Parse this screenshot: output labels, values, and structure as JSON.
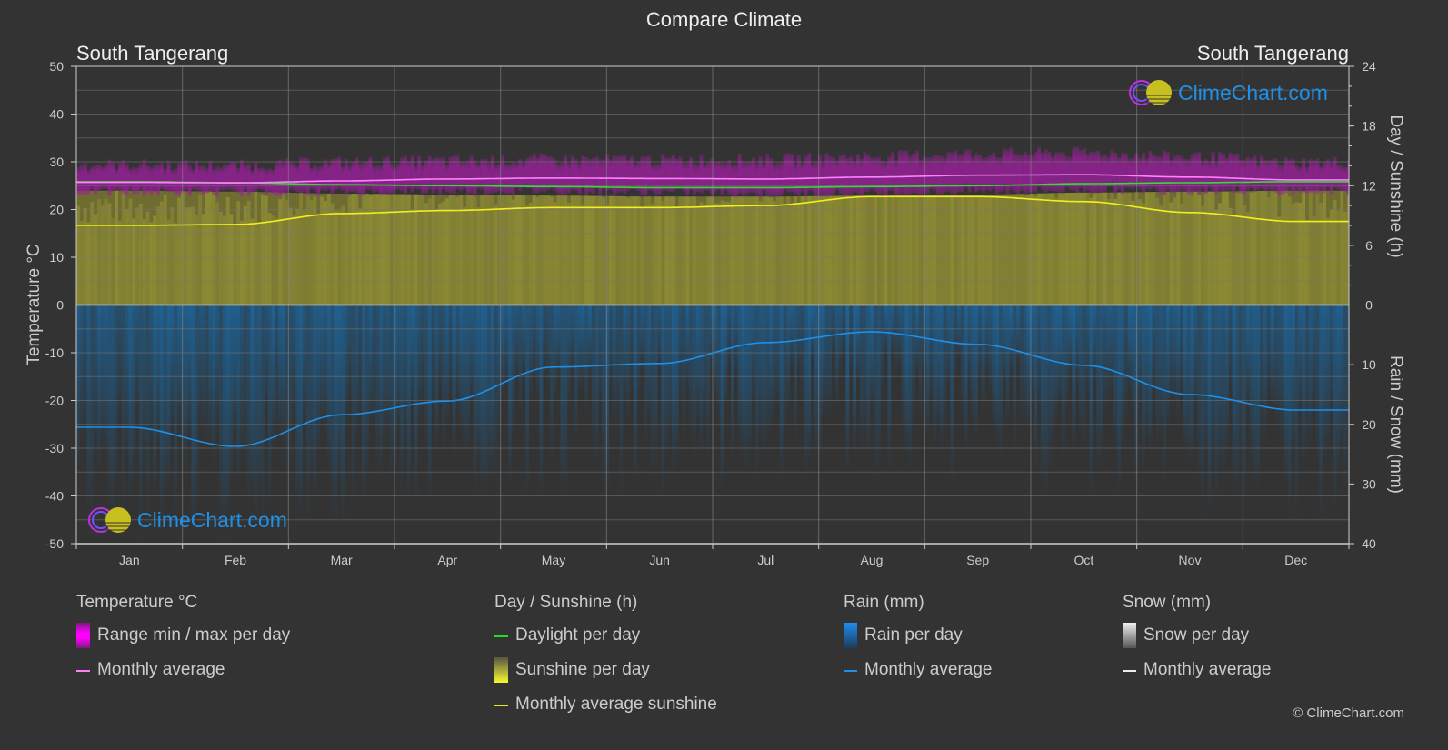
{
  "title": "Compare Climate",
  "location_left": "South Tangerang",
  "location_right": "South Tangerang",
  "logo_text": "ClimeChart.com",
  "copyright": "© ClimeChart.com",
  "colors": {
    "background": "#333333",
    "temp_range": "#b020b0",
    "temp_avg": "#ff80ff",
    "daylight": "#33dd33",
    "sunshine_fill": "#8c8a35",
    "sunshine_avg": "#f0f020",
    "rain_fill": "#1f5f8f",
    "rain_avg": "#1e90e8",
    "grid": "#6a6a6a"
  },
  "legend": {
    "temperature": {
      "title": "Temperature °C",
      "items": [
        "Range min / max per day",
        "Monthly average"
      ]
    },
    "sunshine": {
      "title": "Day / Sunshine (h)",
      "items": [
        "Daylight per day",
        "Sunshine per day",
        "Monthly average sunshine"
      ]
    },
    "rain": {
      "title": "Rain (mm)",
      "items": [
        "Rain per day",
        "Monthly average"
      ]
    },
    "snow": {
      "title": "Snow (mm)",
      "items": [
        "Snow per day",
        "Monthly average"
      ]
    }
  },
  "chart_data": {
    "type": "area",
    "title": "Compare Climate",
    "categories": [
      "Jan",
      "Feb",
      "Mar",
      "Apr",
      "May",
      "Jun",
      "Jul",
      "Aug",
      "Sep",
      "Oct",
      "Nov",
      "Dec"
    ],
    "left_axis": {
      "label": "Temperature °C",
      "range": [
        -50,
        50
      ],
      "ticks": [
        50,
        40,
        30,
        20,
        10,
        0,
        -10,
        -20,
        -30,
        -40,
        -50
      ]
    },
    "right_axis_top": {
      "label": "Day / Sunshine (h)",
      "range": [
        0,
        24
      ],
      "ticks": [
        24,
        18,
        12,
        6,
        0
      ]
    },
    "right_axis_bottom": {
      "label": "Rain / Snow (mm)",
      "range": [
        0,
        40
      ],
      "ticks": [
        10,
        20,
        30,
        40
      ]
    },
    "grid": true,
    "legend_position": "bottom",
    "series": [
      {
        "name": "Temperature range min",
        "unit": "°C",
        "values": [
          23.5,
          23.5,
          23.6,
          23.8,
          23.9,
          23.6,
          23.3,
          23.4,
          23.8,
          24.0,
          24.0,
          23.7
        ]
      },
      {
        "name": "Temperature range max",
        "unit": "°C",
        "values": [
          29.5,
          29.3,
          30.0,
          30.3,
          30.6,
          30.5,
          30.6,
          31.2,
          31.8,
          32.0,
          31.2,
          30.0
        ]
      },
      {
        "name": "Temperature monthly average",
        "unit": "°C",
        "values": [
          25.7,
          25.6,
          26.0,
          26.4,
          26.6,
          26.5,
          26.4,
          26.8,
          27.2,
          27.3,
          26.8,
          26.2
        ]
      },
      {
        "name": "Daylight per day",
        "unit": "h",
        "values": [
          12.4,
          12.3,
          12.1,
          12.0,
          11.9,
          11.8,
          11.8,
          11.9,
          12.0,
          12.2,
          12.3,
          12.4
        ]
      },
      {
        "name": "Monthly average sunshine",
        "unit": "h",
        "values": [
          8.0,
          8.1,
          9.2,
          9.5,
          9.8,
          9.8,
          10.0,
          10.9,
          10.9,
          10.4,
          9.3,
          8.4
        ]
      },
      {
        "name": "Rain monthly average",
        "unit": "mm",
        "values": [
          20.5,
          23.7,
          18.4,
          16.1,
          10.4,
          9.8,
          6.3,
          4.5,
          6.6,
          10.1,
          15.0,
          17.6
        ]
      },
      {
        "name": "Snow monthly average",
        "unit": "mm",
        "values": [
          0,
          0,
          0,
          0,
          0,
          0,
          0,
          0,
          0,
          0,
          0,
          0
        ]
      }
    ]
  }
}
